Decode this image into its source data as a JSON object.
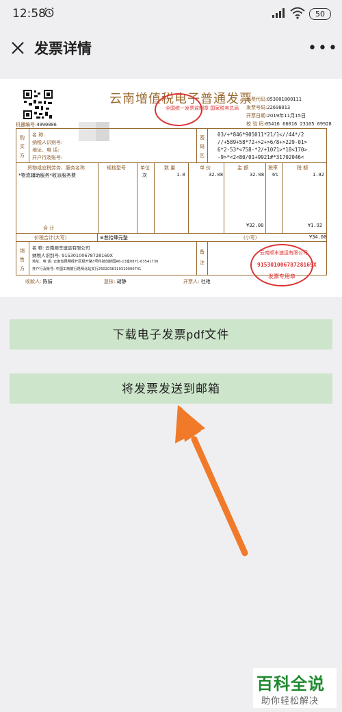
{
  "status_bar": {
    "time": "12:58",
    "battery": "50"
  },
  "header": {
    "title": "发票详情"
  },
  "invoice": {
    "title": "云南增值税电子普通发票",
    "stamp_top": "全国统一发票监制章 国家税务总局",
    "meta": [
      {
        "label": "发票代码:",
        "value": "053001800111"
      },
      {
        "label": "发票号码:",
        "value": "22698013"
      },
      {
        "label": "开票日期:",
        "value": "2019年11月15日"
      },
      {
        "label": "校 验 码:",
        "value": "05416 66016 23105 69928"
      }
    ],
    "machine_no_label": "机器编号:",
    "machine_no_value": "4990006",
    "buyer_side_label": "购买方",
    "buyer_labels": [
      "名  称:",
      "纳税人识别号:",
      "地址、电 话:",
      "开户行及账号:"
    ],
    "code_area_label": "密码区",
    "cipher_lines": [
      "03/+*846*905011*21/1<//44*/2",
      "//+589+58*72+>2+>6/8+>229-01>",
      "6*2-53*<758-*2/+1071>*18<170>",
      "-9>*<2<80/01+9921#*31702046<"
    ],
    "columns": [
      "货物或应税劳务、服务名称",
      "规格型号",
      "单位",
      "数 量",
      "单 价",
      "金 额",
      "税率",
      "税 额"
    ],
    "item": {
      "name": "*物流辅助服务*收派服务费",
      "spec": "",
      "unit": "次",
      "qty": "1.0",
      "price": "32.08",
      "amount": "32.08",
      "rate": "6%",
      "tax": "1.92"
    },
    "subtotal_label": "合     计",
    "subtotal_amount": "¥32.08",
    "subtotal_tax": "¥1.92",
    "total_label": "价税合计(大写)",
    "total_words": "⊗叁拾肆元整",
    "total_small_label": "(小写)",
    "total_small": "¥34.00",
    "seller_side_label": "销售方",
    "seller_lines": [
      "名    称: 云南顺丰速运有限公司",
      "纳税人识别号: 91530100678728169X",
      "地址、电 话: 云南省昆明经开区经开路3号科技创新园A6-13室0871-63541736",
      "开户行及账号: 中国工商银行昆明北站支行2502036119310000741"
    ],
    "remark_label": "备注",
    "stamp_seller": {
      "name": "云南顺丰速运有限公司",
      "tax_id": "91530100678728169X",
      "label": "发票专用章"
    },
    "footer": [
      {
        "label": "收款人:",
        "value": "陈娟"
      },
      {
        "label": "复核:",
        "value": "胡静"
      },
      {
        "label": "开票人:",
        "value": "杜艳"
      }
    ]
  },
  "buttons": {
    "download": "下载电子发票pdf文件",
    "send_email": "将发票发送到邮箱"
  },
  "watermark": {
    "title": "百科全说",
    "subtitle": "助你轻松解决"
  },
  "colors": {
    "accent_button": "#cde5cb",
    "arrow": "#f07a2a",
    "stamp": "#dd3333",
    "invoice_brown": "#9a6a30"
  }
}
